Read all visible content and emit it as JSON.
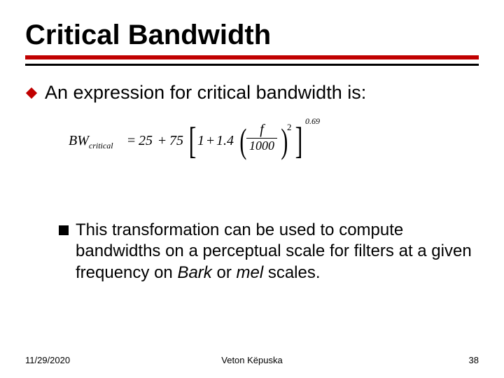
{
  "title": "Critical Bandwidth",
  "bullet_main": "An expression for critical bandwidth is:",
  "formula": {
    "lhs_var": "BW",
    "lhs_sub": "critical",
    "eq": "=",
    "c1": "25",
    "plus": "+",
    "c2": "75",
    "lbracket": "[",
    "one": "1",
    "coef": "1.4",
    "lparen": "(",
    "num": "f",
    "den": "1000",
    "rparen": ")",
    "square": "2",
    "rbracket": "]",
    "outer_exp": "0.69"
  },
  "bullet_sub_pre": "This transformation can be used to compute bandwidths on a perceptual scale for filters at a given frequency on ",
  "bullet_sub_em1": "Bark",
  "bullet_sub_mid": " or ",
  "bullet_sub_em2": "mel",
  "bullet_sub_post": " scales.",
  "footer": {
    "date": "11/29/2020",
    "author": "Veton Këpuska",
    "page": "38"
  }
}
